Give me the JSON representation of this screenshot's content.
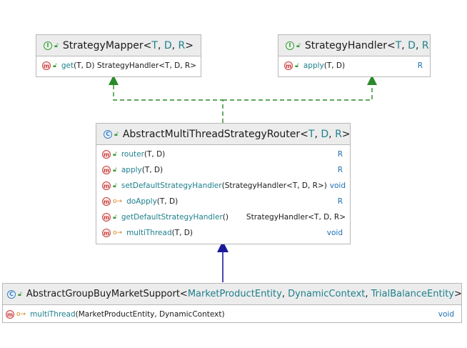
{
  "colors": {
    "implements_edge": "#2a8a2a",
    "extends_edge": "#1a1a9a",
    "type_param": "#1e7f8c",
    "return_type": "#1e6fb0"
  },
  "nodes": {
    "strategy_mapper": {
      "kind": "interface",
      "name": "StrategyMapper",
      "type_params": [
        "T",
        "D",
        "R"
      ],
      "methods": [
        {
          "name": "get",
          "params": "(T, D)",
          "returns": "StrategyHandler<T, D, R>",
          "visibility": "public"
        }
      ]
    },
    "strategy_handler": {
      "kind": "interface",
      "name": "StrategyHandler",
      "type_params": [
        "T",
        "D",
        "R"
      ],
      "methods": [
        {
          "name": "apply",
          "params": "(T, D)",
          "returns": "R",
          "visibility": "public"
        }
      ]
    },
    "abstract_router": {
      "kind": "class",
      "name": "AbstractMultiThreadStrategyRouter",
      "type_params": [
        "T",
        "D",
        "R"
      ],
      "methods": [
        {
          "name": "router",
          "params": "(T, D)",
          "returns": "R",
          "visibility": "public"
        },
        {
          "name": "apply",
          "params": "(T, D)",
          "returns": "R",
          "visibility": "public"
        },
        {
          "name": "setDefaultStrategyHandler",
          "params": "(StrategyHandler<T, D, R>)",
          "returns": "void",
          "visibility": "public"
        },
        {
          "name": "doApply",
          "params": "(T, D)",
          "returns": "R",
          "visibility": "protected"
        },
        {
          "name": "getDefaultStrategyHandler",
          "params": "()",
          "returns": "StrategyHandler<T, D, R>",
          "visibility": "public"
        },
        {
          "name": "multiThread",
          "params": "(T, D)",
          "returns": "void",
          "visibility": "protected"
        }
      ]
    },
    "group_buy_support": {
      "kind": "class",
      "name": "AbstractGroupBuyMarketSupport",
      "type_params": [
        "MarketProductEntity",
        "DynamicContext",
        "TrialBalanceEntity"
      ],
      "methods": [
        {
          "name": "multiThread",
          "params": "(MarketProductEntity, DynamicContext)",
          "returns": "void",
          "visibility": "protected"
        }
      ]
    }
  },
  "edges": [
    {
      "from": "abstract_router",
      "to": "strategy_mapper",
      "relation": "implements"
    },
    {
      "from": "abstract_router",
      "to": "strategy_handler",
      "relation": "implements"
    },
    {
      "from": "group_buy_support",
      "to": "abstract_router",
      "relation": "extends"
    }
  ]
}
